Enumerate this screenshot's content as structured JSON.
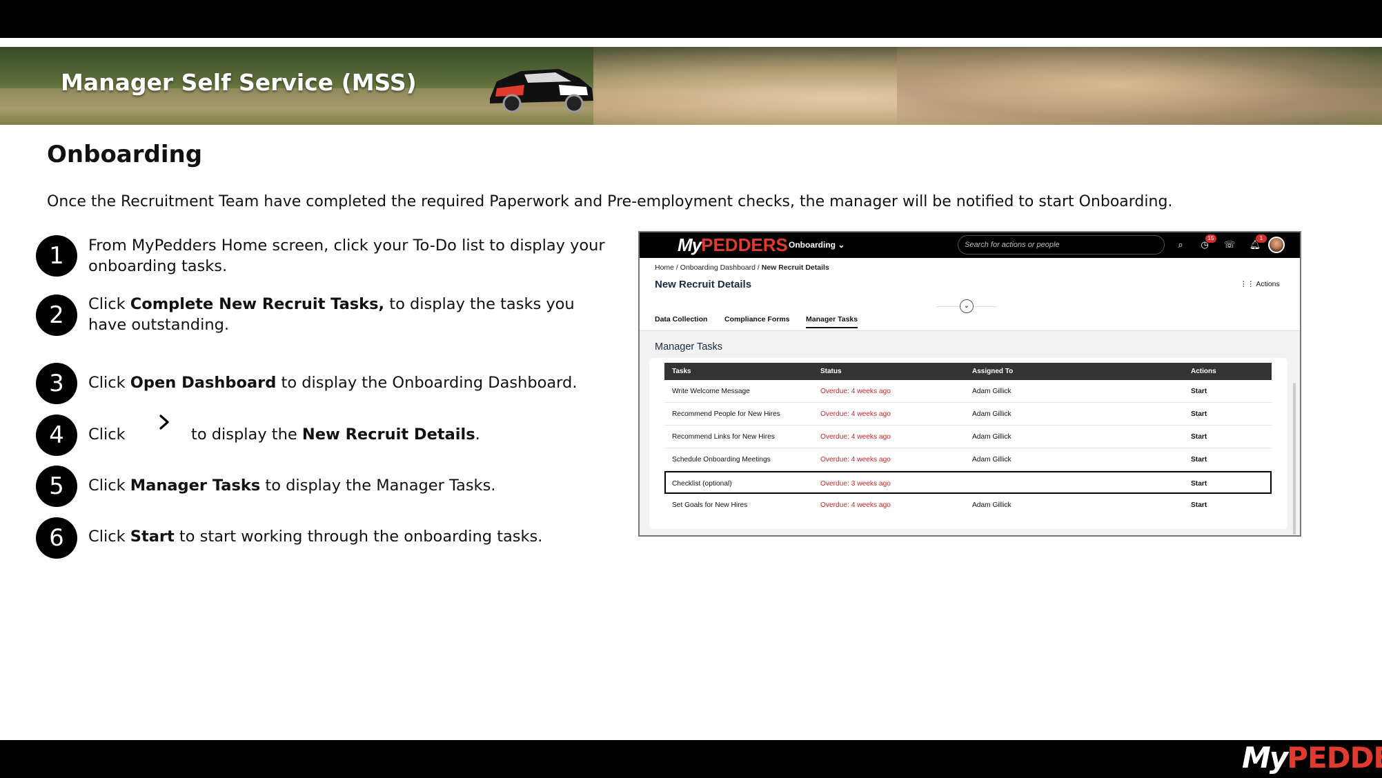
{
  "header": {
    "title": "Manager Self Service (MSS)"
  },
  "section": {
    "title": "Onboarding",
    "intro": "Once the Recruitment Team have completed the required Paperwork and Pre-employment checks, the manager will be notified to start Onboarding."
  },
  "steps": [
    {
      "num": "1",
      "pre": "From MyPedders Home screen, click your To-Do list to display your onboarding tasks.",
      "bold": "",
      "post": ""
    },
    {
      "num": "2",
      "pre": "Click ",
      "bold": "Complete New Recruit Tasks,",
      "post": " to display the tasks you have outstanding."
    },
    {
      "num": "3",
      "pre": "Click ",
      "bold": "Open Dashboard",
      "post": " to display the Onboarding Dashboard."
    },
    {
      "num": "4",
      "pre": "Click",
      "mid": "to display the ",
      "bold": "New Recruit Details",
      "post": "."
    },
    {
      "num": "5",
      "pre": "Click ",
      "bold": "Manager Tasks",
      "post": " to display the Manager Tasks."
    },
    {
      "num": "6",
      "pre": "Click ",
      "bold": "Start",
      "post": " to start working through the onboarding tasks."
    }
  ],
  "app": {
    "logo_my": "My",
    "logo_pedders": "PEDDERS",
    "nav_label": "Onboarding",
    "search_placeholder": "Search for actions or people",
    "todo_badge": "15",
    "notif_badge": "1",
    "breadcrumb": {
      "home": "Home",
      "sep": " / ",
      "dashboard": "Onboarding Dashboard",
      "current": "New Recruit Details"
    },
    "page_title": "New Recruit Details",
    "actions_label": "Actions",
    "tabs": [
      "Data Collection",
      "Compliance Forms",
      "Manager Tasks"
    ],
    "active_tab": "Manager Tasks",
    "panel_title": "Manager Tasks",
    "columns": [
      "Tasks",
      "Status",
      "Assigned To",
      "Actions"
    ],
    "rows": [
      {
        "task": "Write Welcome Message",
        "status": "Overdue: 4 weeks ago",
        "assigned": "Adam Gillick",
        "action": "Start"
      },
      {
        "task": "Recommend People for New Hires",
        "status": "Overdue: 4 weeks ago",
        "assigned": "Adam Gillick",
        "action": "Start"
      },
      {
        "task": "Recommend Links for New Hires",
        "status": "Overdue: 4 weeks ago",
        "assigned": "Adam Gillick",
        "action": "Start"
      },
      {
        "task": "Schedule Onboarding Meetings",
        "status": "Overdue: 4 weeks ago",
        "assigned": "Adam Gillick",
        "action": "Start"
      },
      {
        "task": "Checklist (optional)",
        "status": "Overdue: 3 weeks ago",
        "assigned": "",
        "action": "Start"
      },
      {
        "task": "Set Goals for New Hires",
        "status": "Overdue: 4 weeks ago",
        "assigned": "Adam Gillick",
        "action": "Start"
      }
    ]
  },
  "footer": {
    "logo_my": "My",
    "logo_pedders": "PEDDERS"
  },
  "colors": {
    "accent_red": "#e23a2f",
    "overdue": "#c62828",
    "header_dark": "#333333"
  }
}
